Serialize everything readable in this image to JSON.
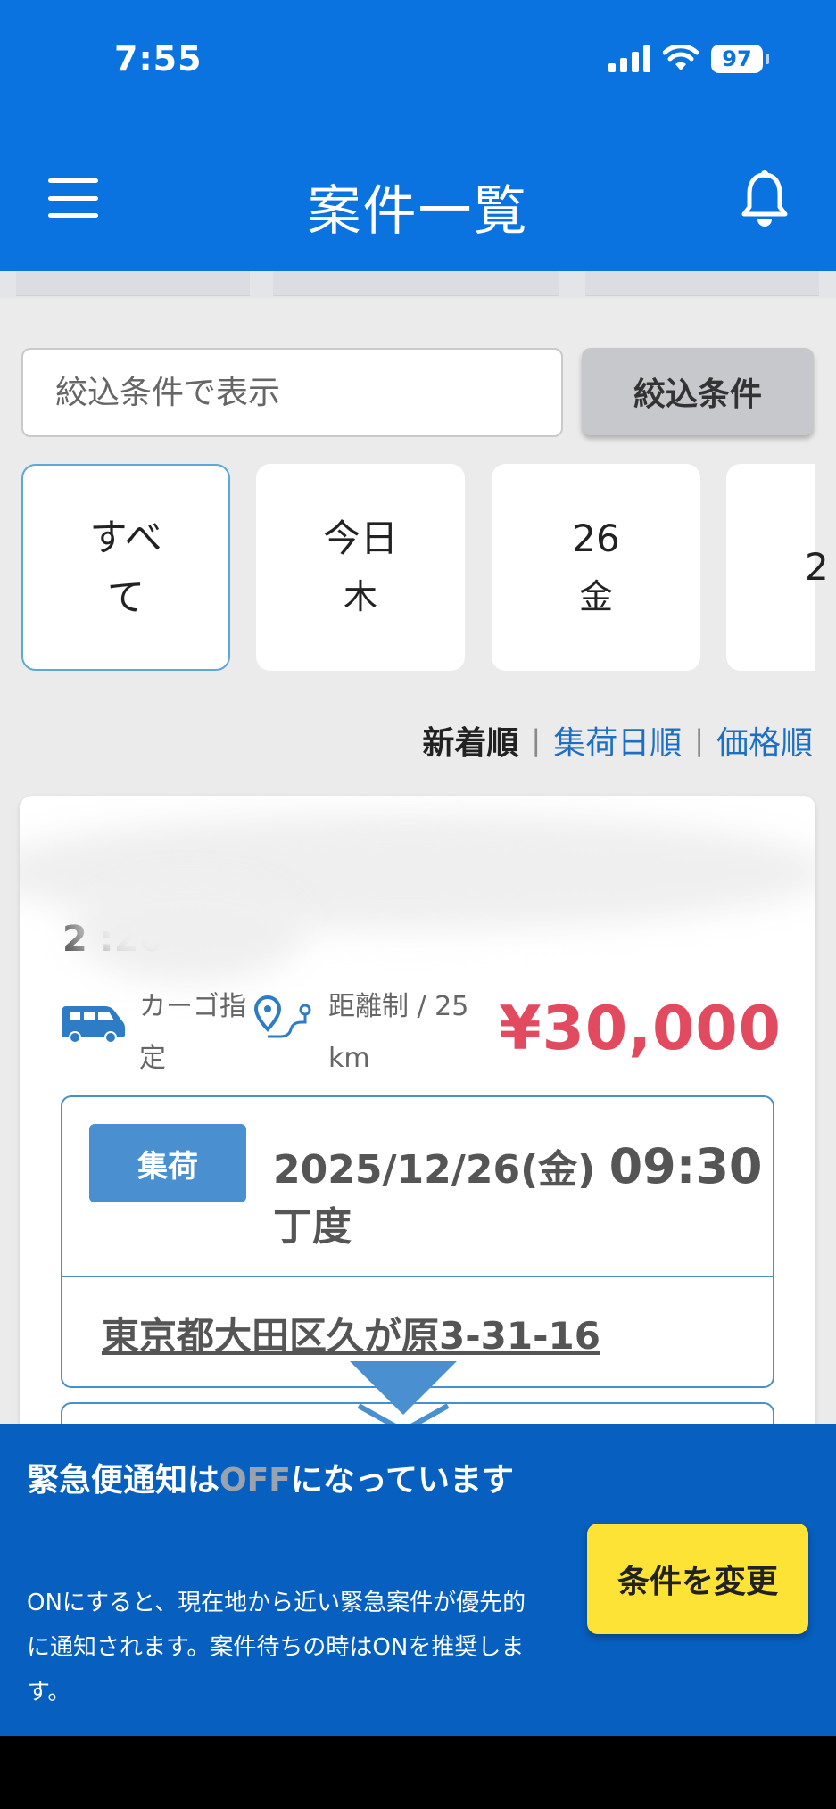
{
  "status_bar": {
    "time": "7:55",
    "battery": "97"
  },
  "header": {
    "title": "案件一覧"
  },
  "search": {
    "placeholder": "絞込条件で表示",
    "filter_label": "絞込条件"
  },
  "date_tabs": [
    {
      "line1": "すべ",
      "line2": "て"
    },
    {
      "line1": "今日",
      "line2": "木"
    },
    {
      "line1": "26",
      "line2": "金"
    },
    {
      "line1": "2",
      "line2": ""
    }
  ],
  "sort": {
    "new": "新着順",
    "pickup": "集荷日順",
    "price": "価格順",
    "separator": "|"
  },
  "job": {
    "partial_date": "2            :20",
    "cargo": "カーゴ指定",
    "distance": "距離制 / 25 km",
    "price": "¥30,000",
    "pickup_badge": "集荷",
    "pickup_date": "2025/12/26(金) ",
    "pickup_time": "09:30",
    "pickup_suffix": "丁度",
    "address": "東京都大田区久が原3-31-16"
  },
  "notification": {
    "title_before": "緊急便通知は",
    "title_off": "OFF",
    "title_after": "になっています",
    "description": "ONにすると、現在地から近い緊急案件が優先的に通知されます。案件待ちの時はONを推奨します。",
    "button": "条件を変更"
  },
  "colors": {
    "brand": "#0a73e0",
    "price": "#e24a5f",
    "badge": "#4a8fcf",
    "notify_button": "#fde335"
  }
}
